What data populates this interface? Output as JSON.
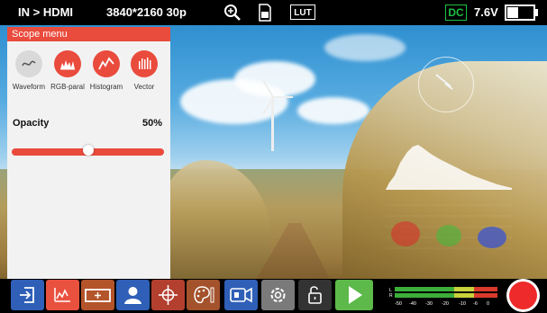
{
  "topbar": {
    "input": "IN > HDMI",
    "resolution": "3840*2160 30p",
    "lut": "LUT",
    "power_source": "DC",
    "voltage": "7.6V"
  },
  "scope_menu": {
    "title": "Scope menu",
    "scopes": [
      {
        "label": "Waveform",
        "icon": "waveform-icon",
        "active": false
      },
      {
        "label": "RGB-paral",
        "icon": "rgb-parade-icon",
        "active": true
      },
      {
        "label": "Histogram",
        "icon": "histogram-icon",
        "active": true
      },
      {
        "label": "Vector",
        "icon": "vector-icon",
        "active": true
      }
    ],
    "opacity_label": "Opacity",
    "opacity_value": "50%",
    "opacity_fraction": 0.5
  },
  "toolbar": {
    "buttons": [
      {
        "name": "input-button",
        "icon": "input-icon",
        "color": "#2f5fb7"
      },
      {
        "name": "scope-button",
        "icon": "scope-icon",
        "color": "#e9513f"
      },
      {
        "name": "zoom-frame-button",
        "icon": "frame-icon",
        "color": "#b4542a"
      },
      {
        "name": "false-color-button",
        "icon": "person-icon",
        "color": "#2f5fb7"
      },
      {
        "name": "crosshair-button",
        "icon": "crosshair-icon",
        "color": "#b33f2f"
      },
      {
        "name": "color-button",
        "icon": "palette-icon",
        "color": "#a3522c"
      },
      {
        "name": "camera-button",
        "icon": "camera-icon",
        "color": "#2f5fb7"
      },
      {
        "name": "settings-button",
        "icon": "gear-icon",
        "color": "#7a7a7a"
      },
      {
        "name": "lock-button",
        "icon": "unlock-icon",
        "color": "#333333"
      },
      {
        "name": "play-button",
        "icon": "play-icon",
        "color": "#5db94a"
      }
    ],
    "meter": {
      "channels": [
        "L",
        "R"
      ],
      "ticks": [
        "-50",
        "-40",
        "-30",
        "-20",
        "-10",
        "-6",
        "0"
      ]
    }
  },
  "colors": {
    "accent": "#e94b3c",
    "dc_green": "#1dbf45",
    "record": "#ee2a2a"
  }
}
